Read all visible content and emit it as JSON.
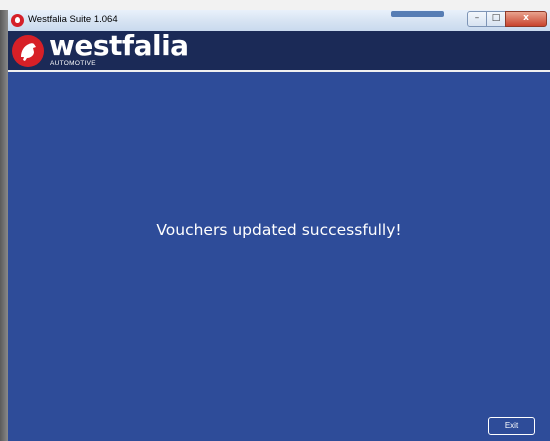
{
  "window": {
    "title": "Westfalia Suite 1.064",
    "controls": {
      "minimize": "–",
      "maximize": "□",
      "close": "x"
    }
  },
  "header": {
    "logo_word": "westfalia",
    "logo_sub": "AUTOMOTIVE",
    "background": "#1b2a57",
    "logo_color": "#d72027"
  },
  "main": {
    "message": "Vouchers updated successfully!",
    "exit_label": "Exit",
    "background": "#2e4c99"
  }
}
